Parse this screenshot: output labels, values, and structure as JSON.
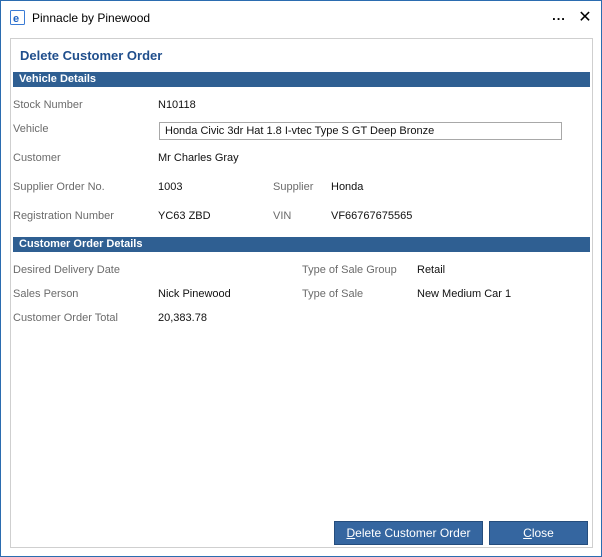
{
  "window": {
    "title": "Pinnacle by Pinewood",
    "more_label": "...",
    "close_label": "✕"
  },
  "dialog": {
    "heading": "Delete Customer Order"
  },
  "vehicle_details": {
    "section_title": "Vehicle Details",
    "stock_number_label": "Stock Number",
    "stock_number": "N10118",
    "vehicle_label": "Vehicle",
    "vehicle": "Honda Civic 3dr Hat 1.8 I-vtec Type S GT Deep Bronze",
    "customer_label": "Customer",
    "customer": "Mr Charles Gray",
    "supplier_order_label": "Supplier Order No.",
    "supplier_order": "1003",
    "supplier_label": "Supplier",
    "supplier": "Honda",
    "registration_label": "Registration Number",
    "registration": "YC63 ZBD",
    "vin_label": "VIN",
    "vin": "VF66767675565"
  },
  "customer_order_details": {
    "section_title": "Customer Order Details",
    "delivery_date_label": "Desired Delivery Date",
    "delivery_date": "",
    "sale_group_label": "Type of Sale Group",
    "sale_group": "Retail",
    "sales_person_label": "Sales Person",
    "sales_person": "Nick Pinewood",
    "sale_type_label": "Type of Sale",
    "sale_type": "New Medium Car 1",
    "order_total_label": "Customer Order Total",
    "order_total": "20,383.78"
  },
  "buttons": {
    "delete_prefix": "D",
    "delete_rest": "elete Customer Order",
    "close_prefix": "C",
    "close_rest": "lose"
  },
  "colors": {
    "section_bar": "#2f5f92",
    "heading": "#1f4e8c",
    "button": "#3566a0"
  }
}
